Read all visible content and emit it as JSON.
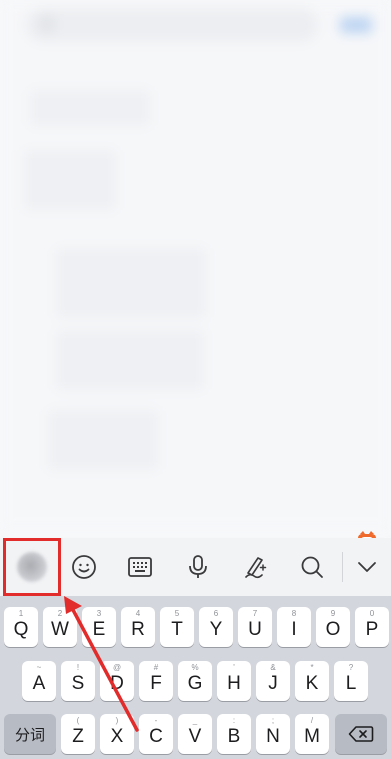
{
  "keyboard": {
    "toolbar": {
      "icons": [
        "app-logo-icon",
        "emoji-icon",
        "keyboard-icon",
        "microphone-icon",
        "handwriting-icon",
        "search-icon",
        "chevron-down-icon"
      ]
    },
    "row1": {
      "keys": [
        {
          "label": "Q",
          "hint": "1"
        },
        {
          "label": "W",
          "hint": "2"
        },
        {
          "label": "E",
          "hint": "3"
        },
        {
          "label": "R",
          "hint": "4"
        },
        {
          "label": "T",
          "hint": "5"
        },
        {
          "label": "Y",
          "hint": "6"
        },
        {
          "label": "U",
          "hint": "7"
        },
        {
          "label": "I",
          "hint": "8"
        },
        {
          "label": "O",
          "hint": "9"
        },
        {
          "label": "P",
          "hint": "0"
        }
      ]
    },
    "row2": {
      "keys": [
        {
          "label": "A",
          "hint": "~"
        },
        {
          "label": "S",
          "hint": "!"
        },
        {
          "label": "D",
          "hint": "@"
        },
        {
          "label": "F",
          "hint": "#"
        },
        {
          "label": "G",
          "hint": "%"
        },
        {
          "label": "H",
          "hint": "'"
        },
        {
          "label": "J",
          "hint": "&"
        },
        {
          "label": "K",
          "hint": "*"
        },
        {
          "label": "L",
          "hint": "?"
        }
      ]
    },
    "row3": {
      "function_label": "分词",
      "keys": [
        {
          "label": "Z",
          "hint": "("
        },
        {
          "label": "X",
          "hint": ")"
        },
        {
          "label": "C",
          "hint": "-"
        },
        {
          "label": "V",
          "hint": "_"
        },
        {
          "label": "B",
          "hint": ":"
        },
        {
          "label": "N",
          "hint": ";"
        },
        {
          "label": "M",
          "hint": "/"
        }
      ],
      "backspace_icon": "backspace-icon"
    }
  },
  "annotation": {
    "highlight_color": "#e22b2b",
    "arrow_color": "#e22b2b"
  },
  "colors": {
    "keyboard_bg": "#d3d6dc",
    "toolbar_bg": "#f2f3f5",
    "key_bg": "#ffffff",
    "function_key_bg": "#b7bbc3"
  }
}
